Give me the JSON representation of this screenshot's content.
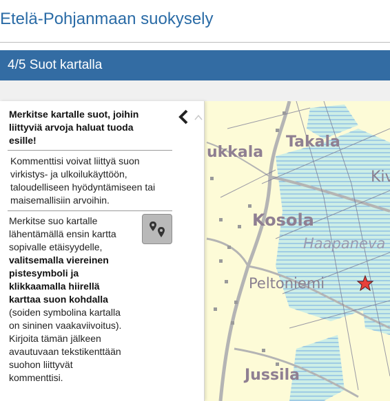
{
  "page": {
    "title": "Etelä-Pohjanmaan suokysely"
  },
  "section": {
    "title": "4/5 Suot kartalla"
  },
  "panel": {
    "header": "Merkitse kartalle suot, joihin liittyviä arvoja haluat tuoda esille!",
    "intro": "Kommenttisi voivat liittyä suon virkistys- ja ulkoilukäyttöön, taloudelliseen hyödyntämiseen tai maisemallisiin arvoihin.",
    "instructions": {
      "part1": "Merkitse suo kartalle lähentämällä ensin kartta sopivalle etäisyydelle, ",
      "part2_bold": "valitsemalla viereinen pistesymboli ja klikkaamalla hiirellä karttaa suon kohdalla",
      "part3": " (soiden symbolina kartalla on sininen vaakaviivoitus). Kirjoita tämän jälkeen avautuvaan tekstikenttään suohon liittyvät kommenttisi."
    },
    "collapse_icon": "chevron-left-icon",
    "point_tool_icon": "map-pins-icon"
  },
  "map": {
    "labels": {
      "ukkala": "ukkala",
      "takala": "Takala",
      "kiv": "Kiv",
      "kosola": "Kosola",
      "haapaneva": "Haapaneva",
      "peltoniemi": "Peltoniemi",
      "jussila": "Jussila"
    },
    "marker_icon": "red-star-marker",
    "colors": {
      "land": "#fdfbd7",
      "bog": "#cfeee8",
      "bog_lines": "#4a90d9",
      "road": "#b4b4b4",
      "marker": "#e8413c"
    }
  },
  "colors": {
    "title": "#2a6ba6",
    "section_bar": "#336ca3"
  }
}
